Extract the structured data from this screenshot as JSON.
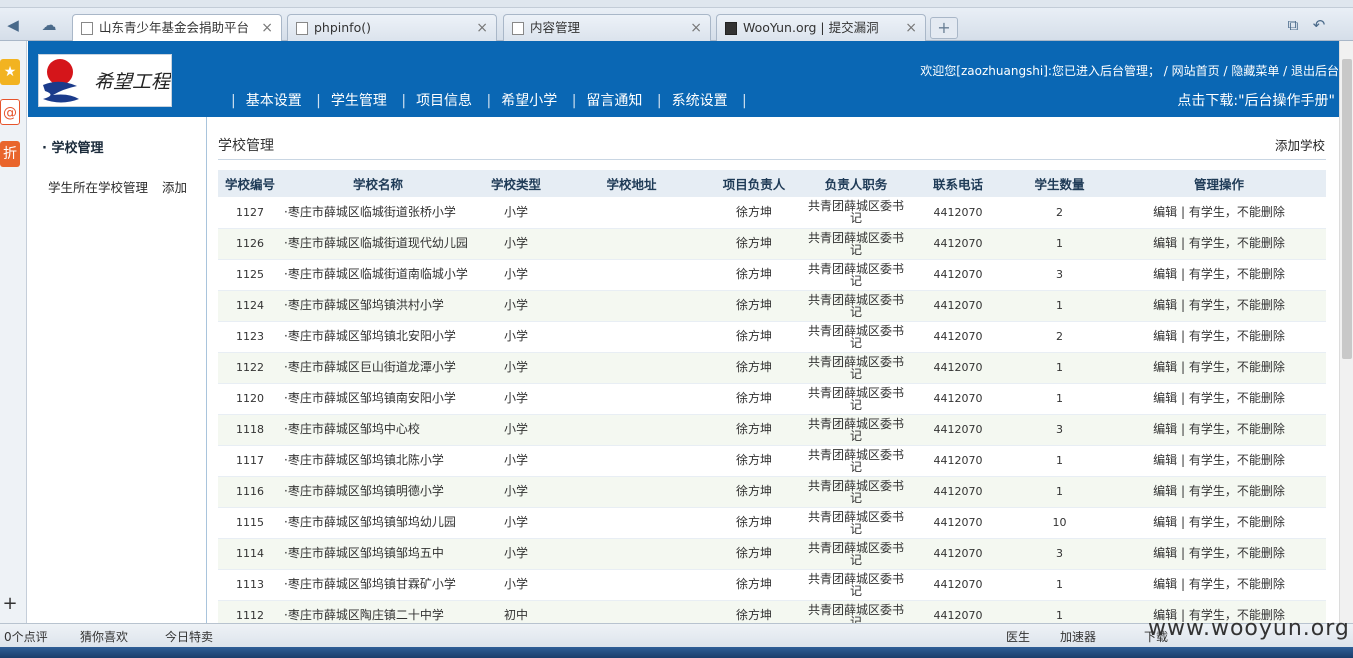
{
  "browser": {
    "tabs": [
      {
        "title": "山东青少年基金会捐助平台",
        "active": true
      },
      {
        "title": "phpinfo()",
        "active": false
      },
      {
        "title": "内容管理",
        "active": false
      },
      {
        "title": "WooYun.org | 提交漏洞",
        "active": false
      }
    ],
    "new_tab": "+",
    "close_glyph": "×",
    "status": {
      "comments": "0个点评",
      "guess": "猜你喜欢",
      "deals": "今日特卖",
      "doctor": "医生",
      "accelerator": "加速器",
      "download": "下载"
    }
  },
  "header": {
    "welcome": "欢迎您[zaozhuangshi]:您已进入后台管理； / 网站首页 / 隐藏菜单 / 退出后台",
    "nav": [
      "基本设置",
      "学生管理",
      "项目信息",
      "希望小学",
      "留言通知",
      "系统设置"
    ],
    "nav_sep": "|",
    "download": "点击下载:\"后台操作手册\""
  },
  "sidebar": {
    "title": "· 学校管理",
    "item": "学生所在学校管理",
    "add": "添加"
  },
  "content": {
    "title": "学校管理",
    "add_school": "添加学校",
    "columns": [
      "学校编号",
      "学校名称",
      "学校类型",
      "学校地址",
      "项目负责人",
      "负责人职务",
      "联系电话",
      "学生数量",
      "管理操作"
    ],
    "rows": [
      {
        "id": "1127",
        "name": "·枣庄市薛城区临城街道张桥小学",
        "type": "小学",
        "address": "",
        "manager": "徐方坤",
        "job": "共青团薛城区委书记",
        "phone": "4412070",
        "count": "2",
        "ops": "编辑 | 有学生，不能删除"
      },
      {
        "id": "1126",
        "name": "·枣庄市薛城区临城街道现代幼儿园",
        "type": "小学",
        "address": "",
        "manager": "徐方坤",
        "job": "共青团薛城区委书记",
        "phone": "4412070",
        "count": "1",
        "ops": "编辑 | 有学生，不能删除"
      },
      {
        "id": "1125",
        "name": "·枣庄市薛城区临城街道南临城小学",
        "type": "小学",
        "address": "",
        "manager": "徐方坤",
        "job": "共青团薛城区委书记",
        "phone": "4412070",
        "count": "3",
        "ops": "编辑 | 有学生，不能删除"
      },
      {
        "id": "1124",
        "name": "·枣庄市薛城区邹坞镇洪村小学",
        "type": "小学",
        "address": "",
        "manager": "徐方坤",
        "job": "共青团薛城区委书记",
        "phone": "4412070",
        "count": "1",
        "ops": "编辑 | 有学生，不能删除"
      },
      {
        "id": "1123",
        "name": "·枣庄市薛城区邹坞镇北安阳小学",
        "type": "小学",
        "address": "",
        "manager": "徐方坤",
        "job": "共青团薛城区委书记",
        "phone": "4412070",
        "count": "2",
        "ops": "编辑 | 有学生，不能删除"
      },
      {
        "id": "1122",
        "name": "·枣庄市薛城区巨山街道龙潭小学",
        "type": "小学",
        "address": "",
        "manager": "徐方坤",
        "job": "共青团薛城区委书记",
        "phone": "4412070",
        "count": "1",
        "ops": "编辑 | 有学生，不能删除"
      },
      {
        "id": "1120",
        "name": "·枣庄市薛城区邹坞镇南安阳小学",
        "type": "小学",
        "address": "",
        "manager": "徐方坤",
        "job": "共青团薛城区委书记",
        "phone": "4412070",
        "count": "1",
        "ops": "编辑 | 有学生，不能删除"
      },
      {
        "id": "1118",
        "name": "·枣庄市薛城区邹坞中心校",
        "type": "小学",
        "address": "",
        "manager": "徐方坤",
        "job": "共青团薛城区委书记",
        "phone": "4412070",
        "count": "3",
        "ops": "编辑 | 有学生，不能删除"
      },
      {
        "id": "1117",
        "name": "·枣庄市薛城区邹坞镇北陈小学",
        "type": "小学",
        "address": "",
        "manager": "徐方坤",
        "job": "共青团薛城区委书记",
        "phone": "4412070",
        "count": "1",
        "ops": "编辑 | 有学生，不能删除"
      },
      {
        "id": "1116",
        "name": "·枣庄市薛城区邹坞镇明德小学",
        "type": "小学",
        "address": "",
        "manager": "徐方坤",
        "job": "共青团薛城区委书记",
        "phone": "4412070",
        "count": "1",
        "ops": "编辑 | 有学生，不能删除"
      },
      {
        "id": "1115",
        "name": "·枣庄市薛城区邹坞镇邹坞幼儿园",
        "type": "小学",
        "address": "",
        "manager": "徐方坤",
        "job": "共青团薛城区委书记",
        "phone": "4412070",
        "count": "10",
        "ops": "编辑 | 有学生，不能删除"
      },
      {
        "id": "1114",
        "name": "·枣庄市薛城区邹坞镇邹坞五中",
        "type": "小学",
        "address": "",
        "manager": "徐方坤",
        "job": "共青团薛城区委书记",
        "phone": "4412070",
        "count": "3",
        "ops": "编辑 | 有学生，不能删除"
      },
      {
        "id": "1113",
        "name": "·枣庄市薛城区邹坞镇甘霖矿小学",
        "type": "小学",
        "address": "",
        "manager": "徐方坤",
        "job": "共青团薛城区委书记",
        "phone": "4412070",
        "count": "1",
        "ops": "编辑 | 有学生，不能删除"
      },
      {
        "id": "1112",
        "name": "·枣庄市薛城区陶庄镇二十中学",
        "type": "初中",
        "address": "",
        "manager": "徐方坤",
        "job": "共青团薛城区委书记",
        "phone": "4412070",
        "count": "1",
        "ops": "编辑 | 有学生，不能删除"
      }
    ]
  },
  "watermark": "www.wooyun.org"
}
